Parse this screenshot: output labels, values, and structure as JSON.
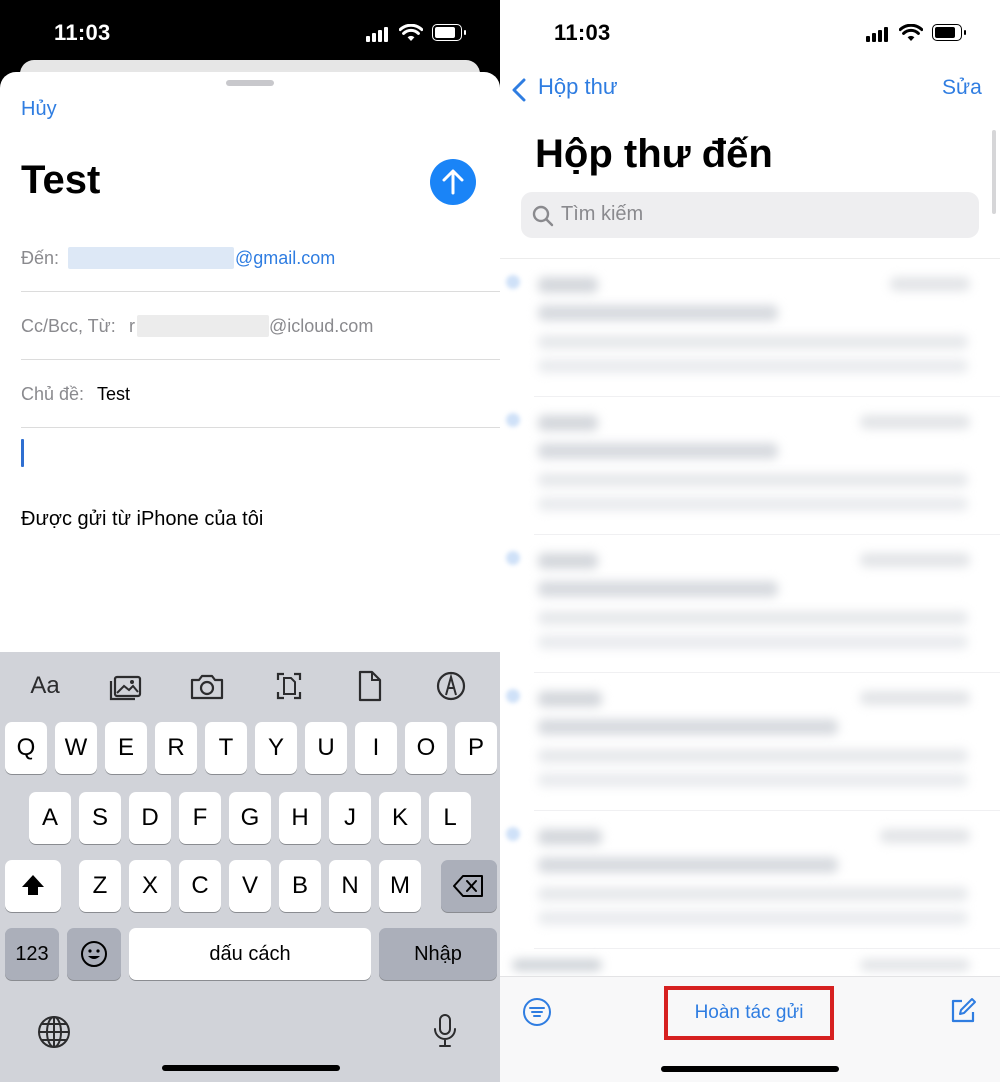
{
  "compose": {
    "status_time": "11:03",
    "cancel_label": "Hủy",
    "title": "Test",
    "to_label": "Đến:",
    "to_domain": "@gmail.com",
    "ccbcc_label": "Cc/Bcc, Từ:",
    "from_prefix": "r",
    "from_domain": "@icloud.com",
    "subject_label": "Chủ đề:",
    "subject_value": "Test",
    "signature": "Được gửi từ iPhone của tôi",
    "send_icon": "arrow-up-icon",
    "accent_color": "#1a84f7"
  },
  "keyboard": {
    "toolbar": [
      {
        "icon": "text-format-icon",
        "label": "Aa"
      },
      {
        "icon": "photo-library-icon"
      },
      {
        "icon": "camera-icon"
      },
      {
        "icon": "scan-document-icon"
      },
      {
        "icon": "document-icon"
      },
      {
        "icon": "markup-icon"
      }
    ],
    "row1": [
      "Q",
      "W",
      "E",
      "R",
      "T",
      "Y",
      "U",
      "I",
      "O",
      "P"
    ],
    "row2": [
      "A",
      "S",
      "D",
      "F",
      "G",
      "H",
      "J",
      "K",
      "L"
    ],
    "row3": [
      "Z",
      "X",
      "C",
      "V",
      "B",
      "N",
      "M"
    ],
    "numbers_label": "123",
    "space_label": "dấu cách",
    "return_label": "Nhập"
  },
  "inbox": {
    "status_time": "11:03",
    "back_label": "Hộp thư",
    "edit_label": "Sửa",
    "title": "Hộp thư đến",
    "search_placeholder": "Tìm kiếm",
    "undo_send_label": "Hoàn tác gửi",
    "highlight_color": "#d62020",
    "filter_icon": "filter-icon",
    "compose_icon": "compose-icon"
  }
}
